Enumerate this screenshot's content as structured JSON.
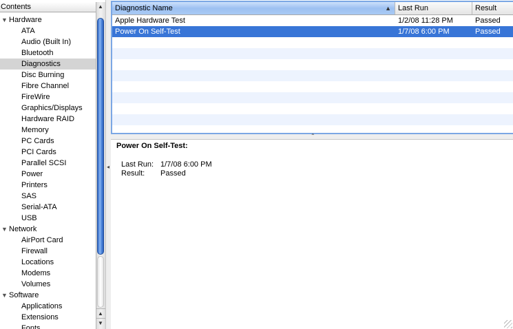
{
  "sidebar": {
    "header": "Contents",
    "tree": [
      {
        "label": "Hardware",
        "kind": "group",
        "expanded": true
      },
      {
        "label": "ATA",
        "kind": "child"
      },
      {
        "label": "Audio (Built In)",
        "kind": "child"
      },
      {
        "label": "Bluetooth",
        "kind": "child"
      },
      {
        "label": "Diagnostics",
        "kind": "child",
        "selected": true
      },
      {
        "label": "Disc Burning",
        "kind": "child"
      },
      {
        "label": "Fibre Channel",
        "kind": "child"
      },
      {
        "label": "FireWire",
        "kind": "child"
      },
      {
        "label": "Graphics/Displays",
        "kind": "child"
      },
      {
        "label": "Hardware RAID",
        "kind": "child"
      },
      {
        "label": "Memory",
        "kind": "child"
      },
      {
        "label": "PC Cards",
        "kind": "child"
      },
      {
        "label": "PCI Cards",
        "kind": "child"
      },
      {
        "label": "Parallel SCSI",
        "kind": "child"
      },
      {
        "label": "Power",
        "kind": "child"
      },
      {
        "label": "Printers",
        "kind": "child"
      },
      {
        "label": "SAS",
        "kind": "child"
      },
      {
        "label": "Serial-ATA",
        "kind": "child"
      },
      {
        "label": "USB",
        "kind": "child"
      },
      {
        "label": "Network",
        "kind": "group",
        "expanded": true
      },
      {
        "label": "AirPort Card",
        "kind": "child"
      },
      {
        "label": "Firewall",
        "kind": "child"
      },
      {
        "label": "Locations",
        "kind": "child"
      },
      {
        "label": "Modems",
        "kind": "child"
      },
      {
        "label": "Volumes",
        "kind": "child"
      },
      {
        "label": "Software",
        "kind": "group",
        "expanded": true
      },
      {
        "label": "Applications",
        "kind": "child"
      },
      {
        "label": "Extensions",
        "kind": "child"
      },
      {
        "label": "Fonts",
        "kind": "child"
      }
    ]
  },
  "table": {
    "columns": [
      "Diagnostic Name",
      "Last Run",
      "Result"
    ],
    "rows": [
      {
        "name": "Apple Hardware Test",
        "last_run": "1/2/08 11:28 PM",
        "result": "Passed"
      },
      {
        "name": "Power On Self-Test",
        "last_run": "1/7/08 6:00 PM",
        "result": "Passed",
        "selected": true
      }
    ],
    "empty_rows": 8
  },
  "detail": {
    "title": "Power On Self-Test:",
    "fields": [
      {
        "key": "Last Run:",
        "value": "1/7/08 6:00 PM"
      },
      {
        "key": "Result:",
        "value": "Passed"
      }
    ]
  },
  "colors": {
    "selection": "#3875d7",
    "accent": "#7ba7e4",
    "sidebar_selection": "#d4d4d4"
  }
}
